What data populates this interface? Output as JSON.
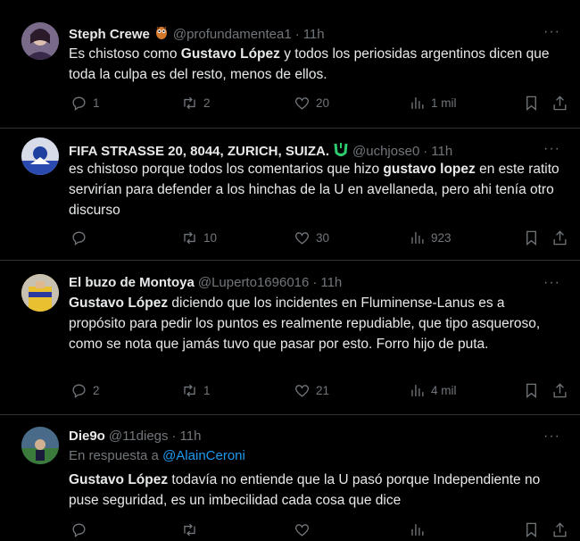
{
  "tweets": [
    {
      "name": "Steph Crewe",
      "handle": "@profundamentea1",
      "time": "11h",
      "text_parts": [
        "Es chistoso como ",
        "Gustavo López",
        " y todos los periosidas argentinos dicen que toda la culpa es del resto, menos de ellos."
      ],
      "stats": {
        "replies": "1",
        "retweets": "2",
        "likes": "20",
        "views": "1 mil"
      }
    },
    {
      "name": "FIFA STRASSE 20, 8044, ZURICH, SUIZA.",
      "handle": "@uchjose0",
      "time": "11h",
      "text_parts": [
        "es chistoso porque todos los comentarios que hizo ",
        "gustavo lopez",
        " en este ratito servirían para defender a los hinchas de la U en avellaneda, pero ahi tenía otro discurso"
      ],
      "stats": {
        "replies": "",
        "retweets": "10",
        "likes": "30",
        "views": "923"
      }
    },
    {
      "name": "El buzo de Montoya",
      "handle": "@Luperto1696016",
      "time": "11h",
      "text_parts": [
        "",
        "Gustavo López",
        " diciendo que los incidentes en Fluminense-Lanus es a propósito para pedir los puntos es realmente repudiable, que tipo asqueroso, como se nota que jamás tuvo que pasar por esto. Forro hijo de puta."
      ],
      "stats": {
        "replies": "2",
        "retweets": "1",
        "likes": "21",
        "views": "4 mil"
      }
    },
    {
      "name": "Die9o",
      "handle": "@11diegs",
      "time": "11h",
      "reply_prefix": "En respuesta a",
      "reply_to": "@AlainCeroni",
      "text_parts": [
        "",
        "Gustavo López",
        " todavía no entiende que la U pasó porque Independiente no puse seguridad, es un imbecilidad cada cosa que dice"
      ]
    }
  ],
  "separator": "·",
  "more_label": "···",
  "colors": {
    "background": "#000000",
    "text": "#e7e9ea",
    "muted": "#71767b",
    "link": "#1d9bf0",
    "border": "#2f3336",
    "verified_green": "#2ecc71"
  }
}
